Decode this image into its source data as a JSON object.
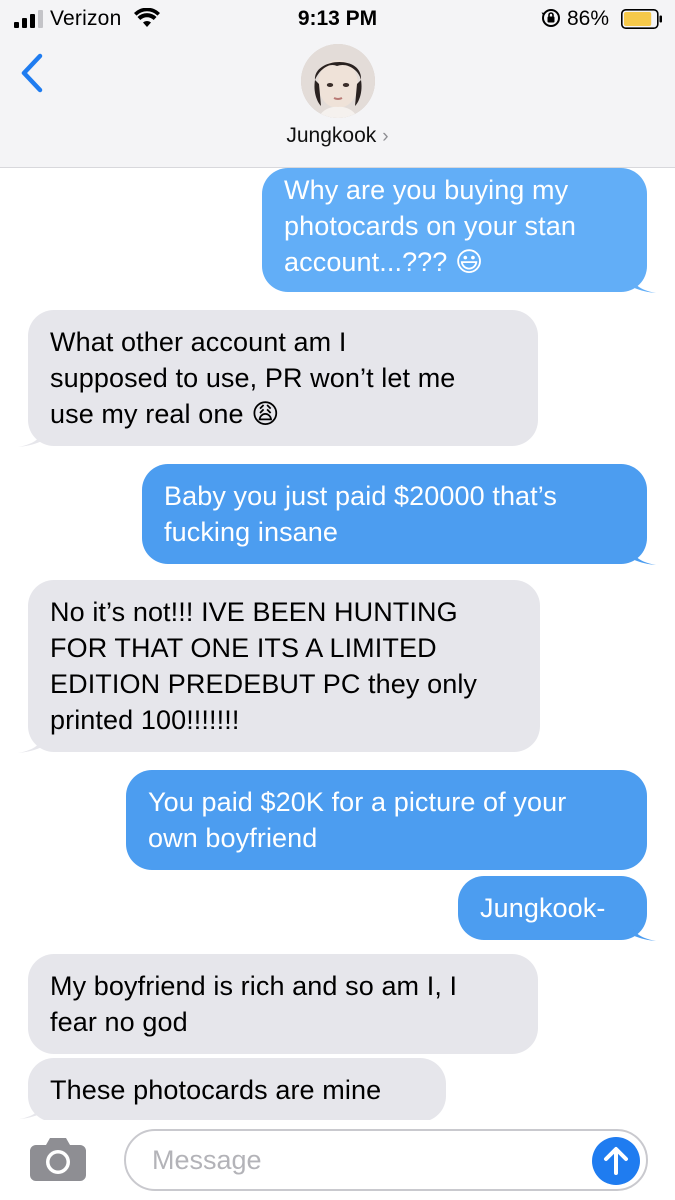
{
  "status_bar": {
    "carrier": "Verizon",
    "time": "9:13 PM",
    "battery_percent": "86%",
    "battery_level": 0.86,
    "signal_icon": "signal-bars-icon",
    "wifi_icon": "wifi-icon",
    "rotation_lock_icon": "rotation-lock-icon",
    "battery_icon": "battery-icon"
  },
  "header": {
    "contact_name": "Jungkook",
    "chevron": "›",
    "back_icon": "chevron-left-icon"
  },
  "messages": [
    {
      "direction": "sent",
      "lines": [
        "Why are you buying my",
        "photocards on your stan",
        "account...??? 😃"
      ]
    },
    {
      "direction": "received",
      "lines": [
        "What other account am I",
        "supposed to use, PR won’t let me",
        "use my real one 😩"
      ]
    },
    {
      "direction": "sent",
      "lines": [
        "Baby you just paid $20000 that’s",
        "fucking insane"
      ]
    },
    {
      "direction": "received",
      "lines": [
        "No it’s not!!! IVE BEEN HUNTING",
        "FOR THAT ONE ITS A LIMITED",
        "EDITION PREDEBUT PC they only",
        "printed 100!!!!!!!"
      ]
    },
    {
      "direction": "sent",
      "lines": [
        "You paid $20K for a picture of your",
        "own boyfriend"
      ]
    },
    {
      "direction": "sent",
      "lines": [
        "Jungkook-"
      ]
    },
    {
      "direction": "received",
      "lines": [
        "My boyfriend is rich and so am I, I",
        "fear no god"
      ]
    },
    {
      "direction": "received",
      "lines": [
        "These photocards are mine"
      ]
    }
  ],
  "input": {
    "placeholder": "Message",
    "camera_icon": "camera-icon",
    "send_icon": "arrow-up-icon"
  },
  "colors": {
    "sent_bubble": "#4c9df0",
    "received_bubble": "#e6e6eb",
    "accent": "#1f7cf0",
    "battery_fill": "#f6c94a"
  }
}
